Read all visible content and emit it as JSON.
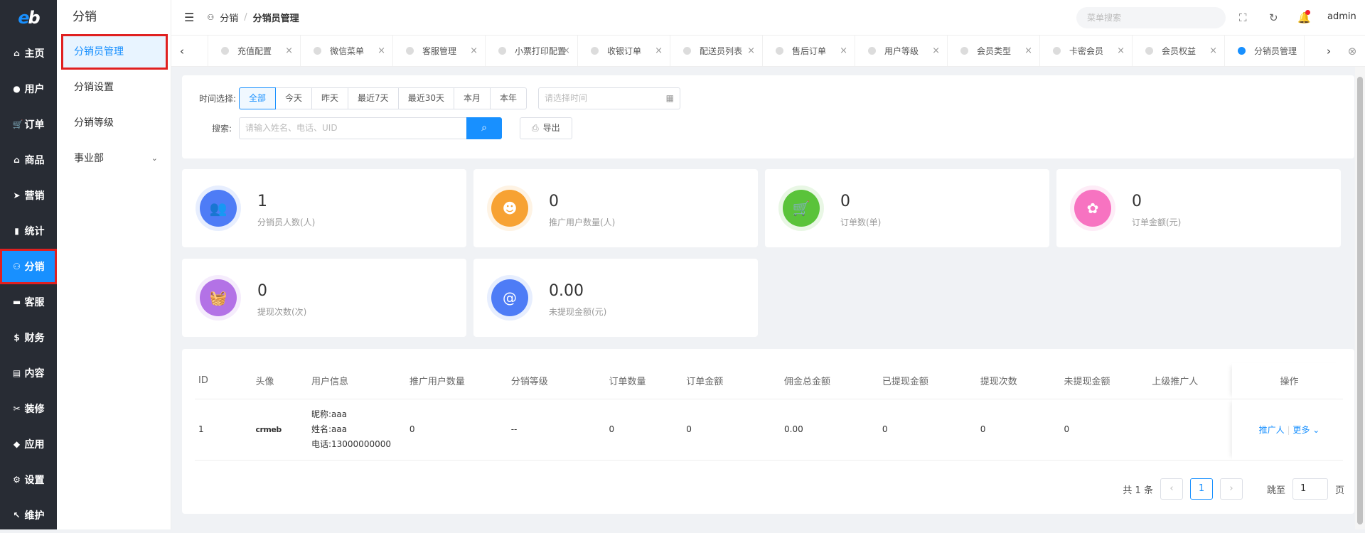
{
  "logo": "eb",
  "rail": [
    {
      "icon": "⌂",
      "label": "主页"
    },
    {
      "icon": "●",
      "label": "用户"
    },
    {
      "icon": "🛒",
      "label": "订单"
    },
    {
      "icon": "⌂",
      "label": "商品"
    },
    {
      "icon": "➤",
      "label": "营销"
    },
    {
      "icon": "▮",
      "label": "统计"
    },
    {
      "icon": "⚇",
      "label": "分销"
    },
    {
      "icon": "▬",
      "label": "客服"
    },
    {
      "icon": "$",
      "label": "财务"
    },
    {
      "icon": "▤",
      "label": "内容"
    },
    {
      "icon": "✂",
      "label": "装修"
    },
    {
      "icon": "◆",
      "label": "应用"
    },
    {
      "icon": "⚙",
      "label": "设置"
    },
    {
      "icon": "↖",
      "label": "维护"
    }
  ],
  "submenu": {
    "title": "分销",
    "items": [
      "分销员管理",
      "分销设置",
      "分销等级",
      "事业部"
    ]
  },
  "topbar": {
    "crumb_root": "分销",
    "crumb_current": "分销员管理",
    "search_placeholder": "菜单搜索",
    "user": "admin"
  },
  "tabs": [
    "充值配置",
    "微信菜单",
    "客服管理",
    "小票打印配置",
    "收银订单",
    "配送员列表",
    "售后订单",
    "用户等级",
    "会员类型",
    "卡密会员",
    "会员权益",
    "分销员管理"
  ],
  "filter": {
    "time_label": "时间选择:",
    "time_options": [
      "全部",
      "今天",
      "昨天",
      "最近7天",
      "最近30天",
      "本月",
      "本年"
    ],
    "date_placeholder": "请选择时间",
    "search_label": "搜索:",
    "search_placeholder": "请输入姓名、电话、UID",
    "export_label": "导出"
  },
  "stats": [
    {
      "value": "1",
      "label": "分销员人数(人)",
      "color": "#4e7cf6",
      "icon": "👥"
    },
    {
      "value": "0",
      "label": "推广用户数量(人)",
      "color": "#f7a233",
      "icon": "☻"
    },
    {
      "value": "0",
      "label": "订单数(单)",
      "color": "#5ac33a",
      "icon": "🛒"
    },
    {
      "value": "0",
      "label": "订单金额(元)",
      "color": "#f773c1",
      "icon": "✿"
    },
    {
      "value": "0",
      "label": "提现次数(次)",
      "color": "#b372e6",
      "icon": "🧺"
    },
    {
      "value": "0.00",
      "label": "未提现金额(元)",
      "color": "#4e7cf6",
      "icon": "@"
    }
  ],
  "table": {
    "headers": [
      "ID",
      "头像",
      "用户信息",
      "推广用户数量",
      "分销等级",
      "订单数量",
      "订单金额",
      "佣金总金额",
      "已提现金额",
      "提现次数",
      "未提现金额",
      "上级推广人",
      "操作"
    ],
    "rows": [
      {
        "id": "1",
        "avatar": "crmeb",
        "nick": "昵称:aaa",
        "name": "姓名:aaa",
        "phone": "电话:13000000000",
        "promo": "0",
        "level": "--",
        "orders": "0",
        "amount": "0",
        "commission": "0.00",
        "withdrawn": "0",
        "withdraw_count": "0",
        "unwithdrawn": "0",
        "parent": "",
        "op1": "推广人",
        "op2": "更多"
      }
    ]
  },
  "pager": {
    "total": "共 1 条",
    "page": "1",
    "jump_label": "跳至",
    "jump_value": "1",
    "page_unit": "页"
  }
}
